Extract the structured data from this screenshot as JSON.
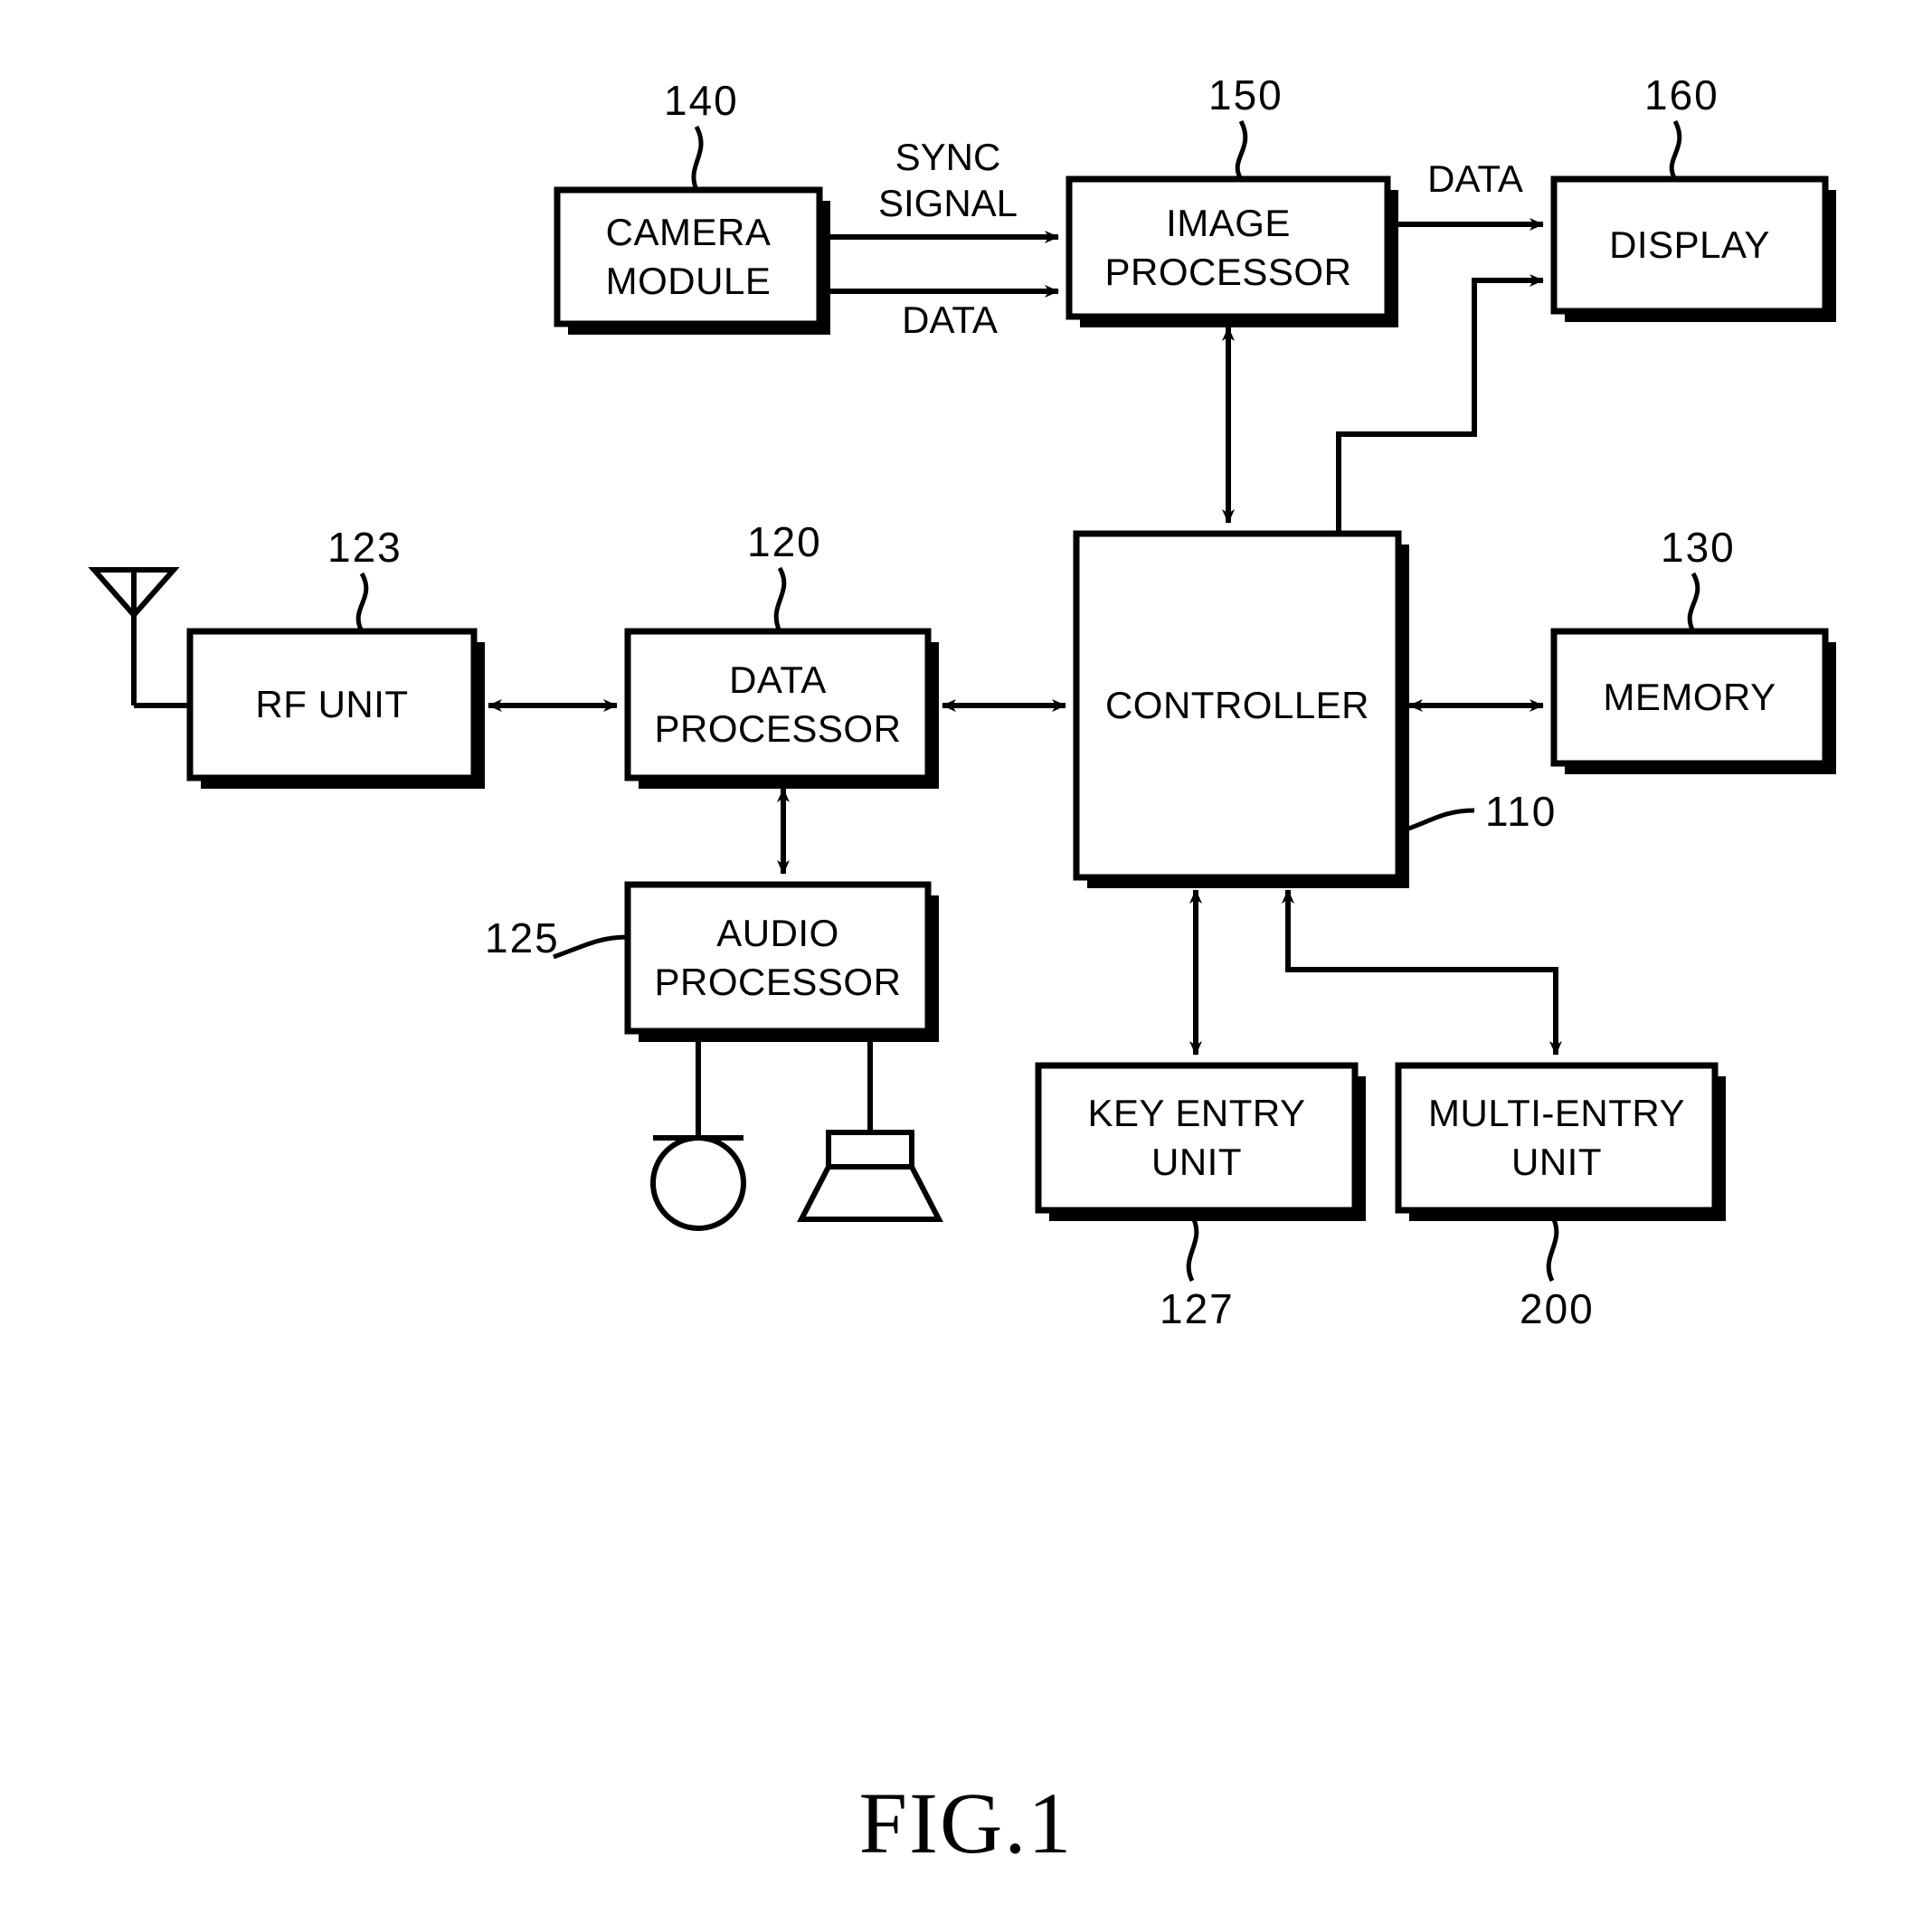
{
  "figure": {
    "caption": "FIG.1",
    "blocks": [
      {
        "id": "camera_module",
        "label": "CAMERA\nMODULE",
        "ref": "140"
      },
      {
        "id": "image_processor",
        "label": "IMAGE\nPROCESSOR",
        "ref": "150"
      },
      {
        "id": "display",
        "label": "DISPLAY",
        "ref": "160"
      },
      {
        "id": "rf_unit",
        "label": "RF UNIT",
        "ref": "123"
      },
      {
        "id": "data_processor",
        "label": "DATA\nPROCESSOR",
        "ref": "120"
      },
      {
        "id": "controller",
        "label": "CONTROLLER",
        "ref": "110"
      },
      {
        "id": "memory",
        "label": "MEMORY",
        "ref": "130"
      },
      {
        "id": "audio_processor",
        "label": "AUDIO\nPROCESSOR",
        "ref": "125"
      },
      {
        "id": "key_entry_unit",
        "label": "KEY ENTRY\nUNIT",
        "ref": "127"
      },
      {
        "id": "multi_entry_unit",
        "label": "MULTI-ENTRY\nUNIT",
        "ref": "200"
      }
    ],
    "edge_labels": [
      {
        "id": "sync_signal",
        "text": "SYNC\nSIGNAL"
      },
      {
        "id": "camera_data",
        "text": "DATA"
      },
      {
        "id": "display_data",
        "text": "DATA"
      }
    ],
    "peripherals": [
      {
        "id": "microphone",
        "icon": "microphone-icon"
      },
      {
        "id": "speaker",
        "icon": "speaker-icon"
      },
      {
        "id": "antenna",
        "icon": "antenna-icon"
      }
    ],
    "colors": {
      "ink": "#000000",
      "paper": "#ffffff"
    }
  }
}
